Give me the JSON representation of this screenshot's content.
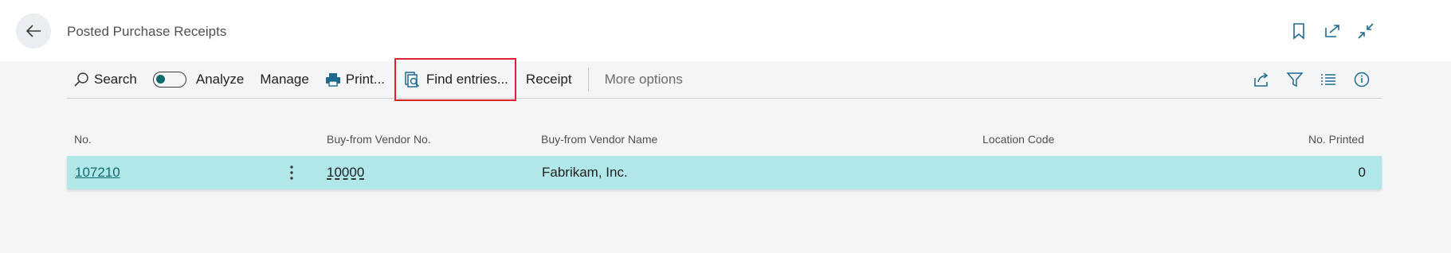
{
  "header": {
    "title": "Posted Purchase Receipts",
    "icons": [
      "bookmark-icon",
      "open-in-new-window-icon",
      "collapse-icon"
    ]
  },
  "toolbar": {
    "search_label": "Search",
    "analyze_label": "Analyze",
    "analyze_on": false,
    "manage_label": "Manage",
    "print_label": "Print...",
    "find_entries_label": "Find entries...",
    "receipt_label": "Receipt",
    "more_options_label": "More options",
    "right_icons": [
      "share-icon",
      "filter-icon",
      "list-view-icon",
      "info-icon"
    ]
  },
  "table": {
    "columns": [
      "No.",
      "Buy-from Vendor No.",
      "Buy-from Vendor Name",
      "Location Code",
      "No. Printed"
    ],
    "rows": [
      {
        "no": "107210",
        "vendor_no": "10000",
        "vendor_name": "Fabrikam, Inc.",
        "location_code": "",
        "no_printed": "0"
      }
    ]
  },
  "colors": {
    "accent": "#0e6a6b",
    "selected_row": "#b2e7ea",
    "highlight_box": "#d9242f"
  }
}
